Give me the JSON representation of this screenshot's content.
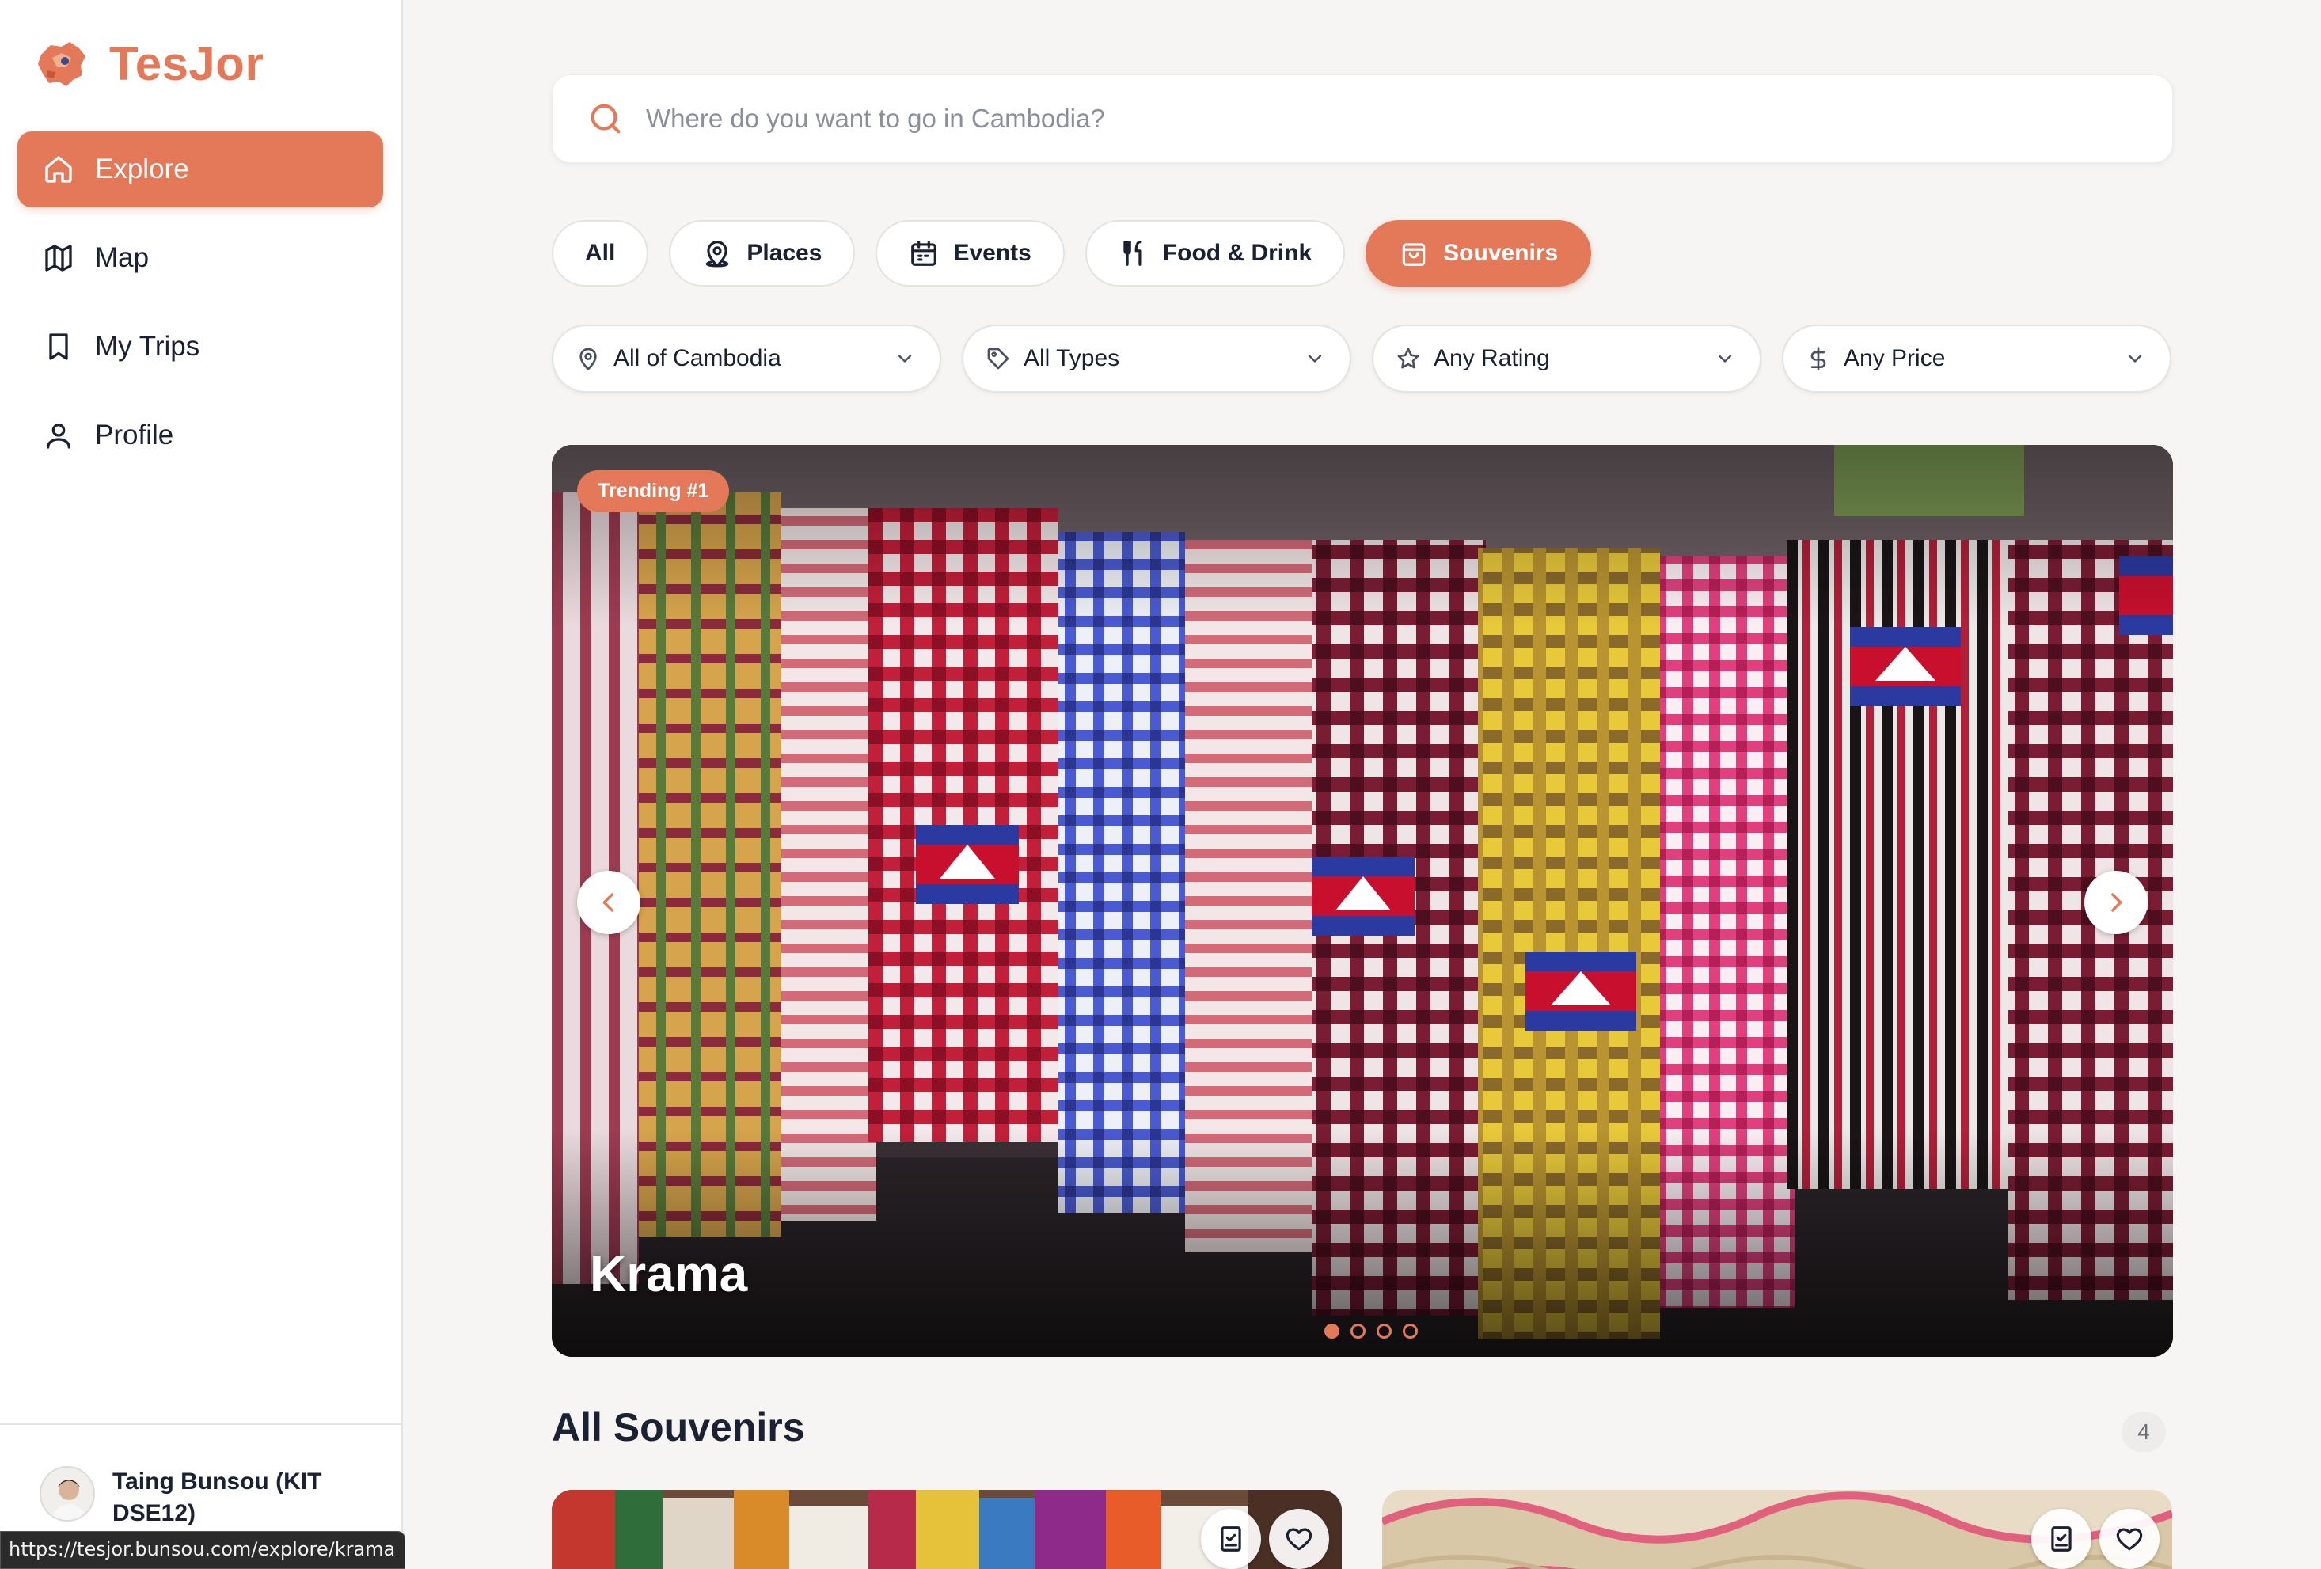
{
  "app": {
    "name": "TesJor"
  },
  "sidebar": {
    "items": [
      {
        "label": "Explore",
        "icon": "home-icon",
        "active": true
      },
      {
        "label": "Map",
        "icon": "map-icon",
        "active": false
      },
      {
        "label": "My Trips",
        "icon": "bookmark-icon",
        "active": false
      },
      {
        "label": "Profile",
        "icon": "user-icon",
        "active": false
      }
    ],
    "user": {
      "name": "Taing Bunsou (KIT DSE12)"
    }
  },
  "status_bar": {
    "url": "https://tesjor.bunsou.com/explore/krama"
  },
  "search": {
    "placeholder": "Where do you want to go in Cambodia?",
    "value": ""
  },
  "tabs": [
    {
      "label": "All",
      "icon": "",
      "active": false
    },
    {
      "label": "Places",
      "icon": "pin-icon",
      "active": false
    },
    {
      "label": "Events",
      "icon": "calendar-icon",
      "active": false
    },
    {
      "label": "Food & Drink",
      "icon": "utensils-icon",
      "active": false
    },
    {
      "label": "Souvenirs",
      "icon": "shopping-bag-icon",
      "active": true
    }
  ],
  "filters": [
    {
      "label": "All of Cambodia",
      "icon": "location-pin-icon"
    },
    {
      "label": "All Types",
      "icon": "tag-icon"
    },
    {
      "label": "Any Rating",
      "icon": "star-icon"
    },
    {
      "label": "Any Price",
      "icon": "dollar-icon"
    }
  ],
  "hero": {
    "badge": "Trending #1",
    "title": "Krama",
    "slide_count": 4,
    "active_slide": 0
  },
  "section": {
    "title": "All Souvenirs",
    "count": "4"
  },
  "colors": {
    "accent": "#e37959",
    "text": "#1a2132",
    "background": "#f6f5f4"
  }
}
